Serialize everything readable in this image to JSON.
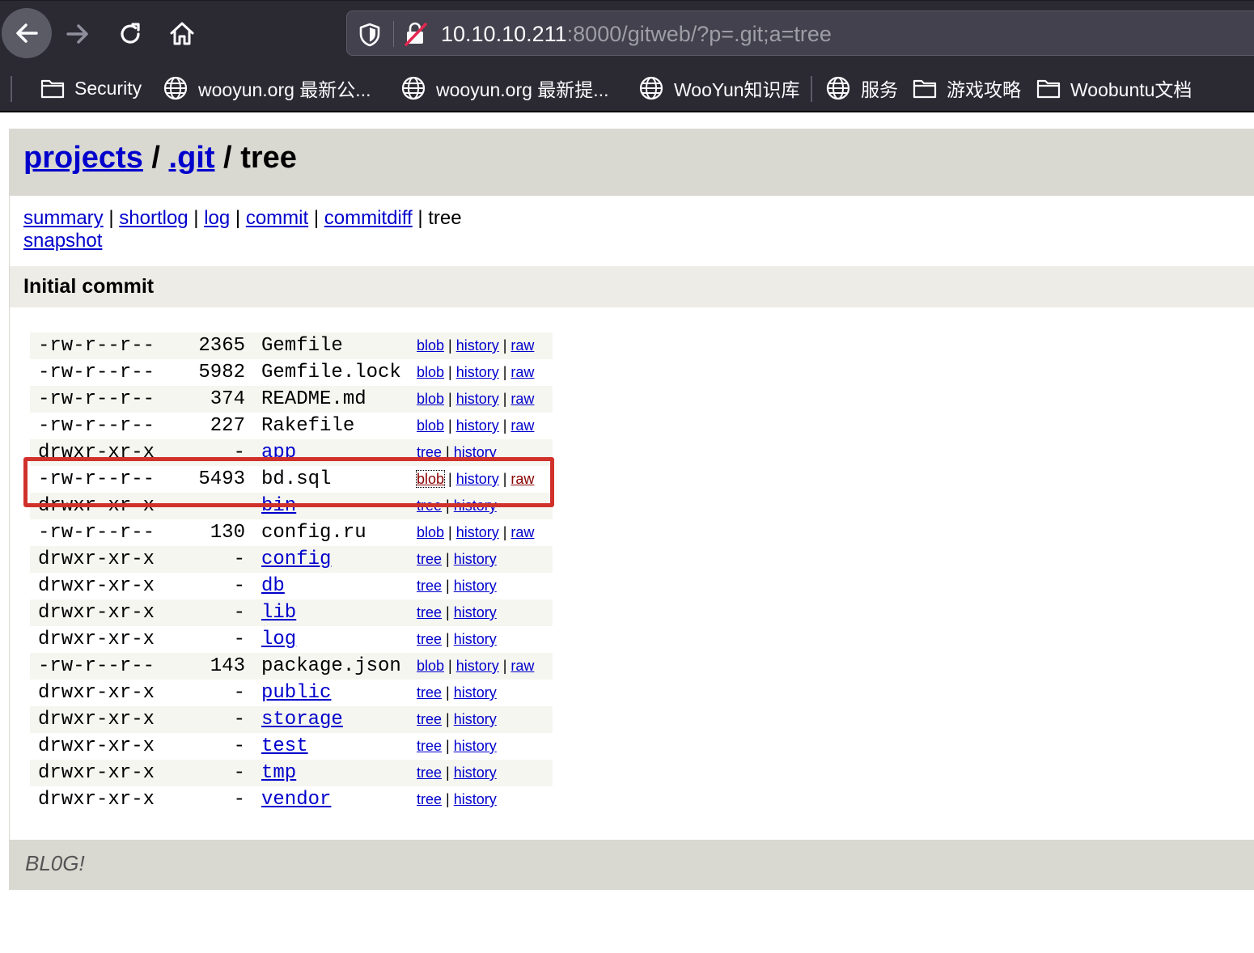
{
  "browser": {
    "url_host": "10.10.10.211",
    "url_rest": ":8000/gitweb/?p=.git;a=tree",
    "icons": {
      "back": "back-arrow-icon",
      "forward": "forward-arrow-icon",
      "reload": "reload-icon",
      "home": "home-icon",
      "shield": "shield-icon",
      "insecure_lock": "insecure-lock-icon"
    },
    "bookmarks": [
      {
        "label": "Security",
        "icon": "folder-icon"
      },
      {
        "label": "wooyun.org 最新公...",
        "icon": "globe-icon"
      },
      {
        "label": "wooyun.org 最新提...",
        "icon": "globe-icon"
      },
      {
        "label": "WooYun知识库",
        "icon": "globe-icon"
      },
      {
        "label": "服务",
        "icon": "globe-icon"
      },
      {
        "label": "游戏攻略",
        "icon": "folder-icon"
      },
      {
        "label": "Woobuntu文档",
        "icon": "folder-icon"
      }
    ]
  },
  "header": {
    "projects_link": "projects",
    "sep1": " / ",
    "repo_link": ".git",
    "sep2": " / ",
    "action": "tree"
  },
  "nav": {
    "summary": "summary",
    "shortlog": "shortlog",
    "log": "log",
    "commit": "commit",
    "commitdiff": "commitdiff",
    "tree": "tree",
    "snapshot": "snapshot",
    "pipe": " | "
  },
  "commit_title": "Initial commit",
  "files": [
    {
      "mode": "-rw-r--r--",
      "size": "2365",
      "name": "Gemfile",
      "type": "file"
    },
    {
      "mode": "-rw-r--r--",
      "size": "5982",
      "name": "Gemfile.lock",
      "type": "file"
    },
    {
      "mode": "-rw-r--r--",
      "size": "374",
      "name": "README.md",
      "type": "file"
    },
    {
      "mode": "-rw-r--r--",
      "size": "227",
      "name": "Rakefile",
      "type": "file"
    },
    {
      "mode": "drwxr-xr-x",
      "size": "-",
      "name": "app",
      "type": "dir"
    },
    {
      "mode": "-rw-r--r--",
      "size": "5493",
      "name": "bd.sql",
      "type": "file"
    },
    {
      "mode": "drwxr-xr-x",
      "size": "-",
      "name": "bin",
      "type": "dir"
    },
    {
      "mode": "-rw-r--r--",
      "size": "130",
      "name": "config.ru",
      "type": "file"
    },
    {
      "mode": "drwxr-xr-x",
      "size": "-",
      "name": "config",
      "type": "dir"
    },
    {
      "mode": "drwxr-xr-x",
      "size": "-",
      "name": "db",
      "type": "dir"
    },
    {
      "mode": "drwxr-xr-x",
      "size": "-",
      "name": "lib",
      "type": "dir"
    },
    {
      "mode": "drwxr-xr-x",
      "size": "-",
      "name": "log",
      "type": "dir"
    },
    {
      "mode": "-rw-r--r--",
      "size": "143",
      "name": "package.json",
      "type": "file"
    },
    {
      "mode": "drwxr-xr-x",
      "size": "-",
      "name": "public",
      "type": "dir"
    },
    {
      "mode": "drwxr-xr-x",
      "size": "-",
      "name": "storage",
      "type": "dir"
    },
    {
      "mode": "drwxr-xr-x",
      "size": "-",
      "name": "test",
      "type": "dir"
    },
    {
      "mode": "drwxr-xr-x",
      "size": "-",
      "name": "tmp",
      "type": "dir"
    },
    {
      "mode": "drwxr-xr-x",
      "size": "-",
      "name": "vendor",
      "type": "dir"
    }
  ],
  "link_labels": {
    "blob": "blob",
    "tree": "tree",
    "history": "history",
    "raw": "raw"
  },
  "highlight_row": "bd.sql",
  "highlight_color": "#d0322b",
  "footer": "BL0G!"
}
